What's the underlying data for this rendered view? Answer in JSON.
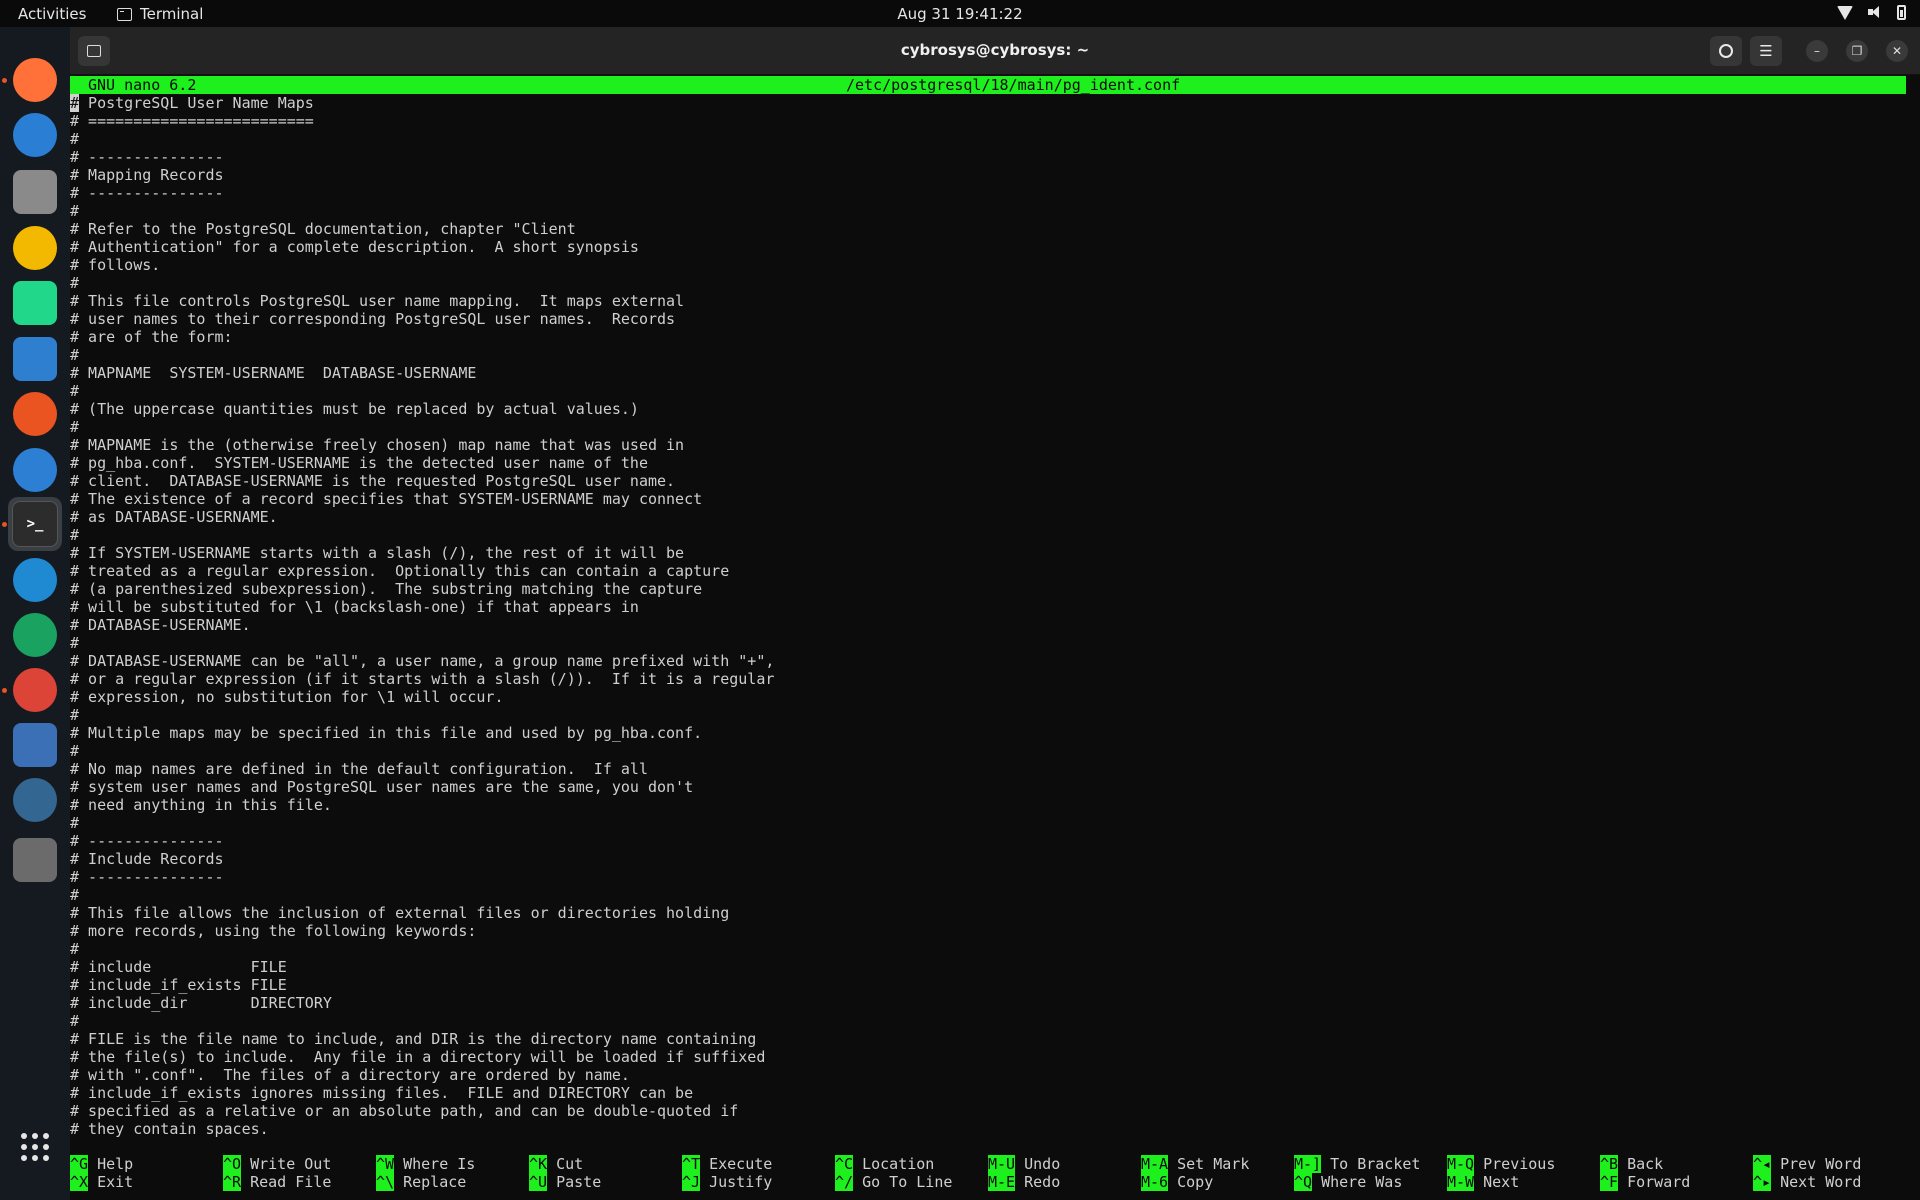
{
  "topbar": {
    "activities": "Activities",
    "app_name": "Terminal",
    "clock": "Aug 31  19:41:22"
  },
  "dock": {
    "items": [
      {
        "icon": "firefox-icon",
        "color": "#ff7139"
      },
      {
        "icon": "thunderbird-icon",
        "color": "#2a7fd4"
      },
      {
        "icon": "files-icon",
        "color": "#8a8a8a"
      },
      {
        "icon": "rhythmbox-icon",
        "color": "#f3b800"
      },
      {
        "icon": "pycharm-icon",
        "color": "#21d789"
      },
      {
        "icon": "libreoffice-writer-icon",
        "color": "#2f7fd1"
      },
      {
        "icon": "app-center-icon",
        "color": "#e95420"
      },
      {
        "icon": "help-icon",
        "color": "#2d7fd3"
      },
      {
        "icon": "terminal-icon",
        "color": "#2c2c2c"
      },
      {
        "icon": "vscode-icon",
        "color": "#1f8ad2"
      },
      {
        "icon": "time-tracker-icon",
        "color": "#1aa260"
      },
      {
        "icon": "chrome-icon",
        "color": "#db4437"
      },
      {
        "icon": "text-editor-icon",
        "color": "#3b6fb6"
      },
      {
        "icon": "pgadmin-icon",
        "color": "#336791"
      },
      {
        "icon": "trash-icon",
        "color": "#6b6b6b"
      },
      {
        "icon": "app-grid-icon",
        "color": "#e6e6e6"
      }
    ]
  },
  "window": {
    "title": "cybrosys@cybrosys: ~"
  },
  "nano": {
    "version": "GNU nano 6.2",
    "filename": "/etc/postgresql/18/main/pg_ident.conf",
    "lines": [
      "# PostgreSQL User Name Maps",
      "# =========================",
      "#",
      "# ---------------",
      "# Mapping Records",
      "# ---------------",
      "#",
      "# Refer to the PostgreSQL documentation, chapter \"Client",
      "# Authentication\" for a complete description.  A short synopsis",
      "# follows.",
      "#",
      "# This file controls PostgreSQL user name mapping.  It maps external",
      "# user names to their corresponding PostgreSQL user names.  Records",
      "# are of the form:",
      "#",
      "# MAPNAME  SYSTEM-USERNAME  DATABASE-USERNAME",
      "#",
      "# (The uppercase quantities must be replaced by actual values.)",
      "#",
      "# MAPNAME is the (otherwise freely chosen) map name that was used in",
      "# pg_hba.conf.  SYSTEM-USERNAME is the detected user name of the",
      "# client.  DATABASE-USERNAME is the requested PostgreSQL user name.",
      "# The existence of a record specifies that SYSTEM-USERNAME may connect",
      "# as DATABASE-USERNAME.",
      "#",
      "# If SYSTEM-USERNAME starts with a slash (/), the rest of it will be",
      "# treated as a regular expression.  Optionally this can contain a capture",
      "# (a parenthesized subexpression).  The substring matching the capture",
      "# will be substituted for \\1 (backslash-one) if that appears in",
      "# DATABASE-USERNAME.",
      "#",
      "# DATABASE-USERNAME can be \"all\", a user name, a group name prefixed with \"+\",",
      "# or a regular expression (if it starts with a slash (/)).  If it is a regular",
      "# expression, no substitution for \\1 will occur.",
      "#",
      "# Multiple maps may be specified in this file and used by pg_hba.conf.",
      "#",
      "# No map names are defined in the default configuration.  If all",
      "# system user names and PostgreSQL user names are the same, you don't",
      "# need anything in this file.",
      "#",
      "# ---------------",
      "# Include Records",
      "# ---------------",
      "#",
      "# This file allows the inclusion of external files or directories holding",
      "# more records, using the following keywords:",
      "#",
      "# include           FILE",
      "# include_if_exists FILE",
      "# include_dir       DIRECTORY",
      "#",
      "# FILE is the file name to include, and DIR is the directory name containing",
      "# the file(s) to include.  Any file in a directory will be loaded if suffixed",
      "# with \".conf\".  The files of a directory are ordered by name.",
      "# include_if_exists ignores missing files.  FILE and DIRECTORY can be",
      "# specified as a relative or an absolute path, and can be double-quoted if",
      "# they contain spaces."
    ],
    "shortcuts": [
      [
        {
          "key": "^G",
          "label": "Help"
        },
        {
          "key": "^X",
          "label": "Exit"
        }
      ],
      [
        {
          "key": "^O",
          "label": "Write Out"
        },
        {
          "key": "^R",
          "label": "Read File"
        }
      ],
      [
        {
          "key": "^W",
          "label": "Where Is"
        },
        {
          "key": "^\\",
          "label": "Replace"
        }
      ],
      [
        {
          "key": "^K",
          "label": "Cut"
        },
        {
          "key": "^U",
          "label": "Paste"
        }
      ],
      [
        {
          "key": "^T",
          "label": "Execute"
        },
        {
          "key": "^J",
          "label": "Justify"
        }
      ],
      [
        {
          "key": "^C",
          "label": "Location"
        },
        {
          "key": "^/",
          "label": "Go To Line"
        }
      ],
      [
        {
          "key": "M-U",
          "label": "Undo"
        },
        {
          "key": "M-E",
          "label": "Redo"
        }
      ],
      [
        {
          "key": "M-A",
          "label": "Set Mark"
        },
        {
          "key": "M-6",
          "label": "Copy"
        }
      ],
      [
        {
          "key": "M-]",
          "label": "To Bracket"
        },
        {
          "key": "^Q",
          "label": "Where Was"
        }
      ],
      [
        {
          "key": "M-Q",
          "label": "Previous"
        },
        {
          "key": "M-W",
          "label": "Next"
        }
      ],
      [
        {
          "key": "^B",
          "label": "Back"
        },
        {
          "key": "^F",
          "label": "Forward"
        }
      ],
      [
        {
          "key": "^◂",
          "label": "Prev Word"
        },
        {
          "key": "^▸",
          "label": "Next Word"
        }
      ]
    ]
  }
}
